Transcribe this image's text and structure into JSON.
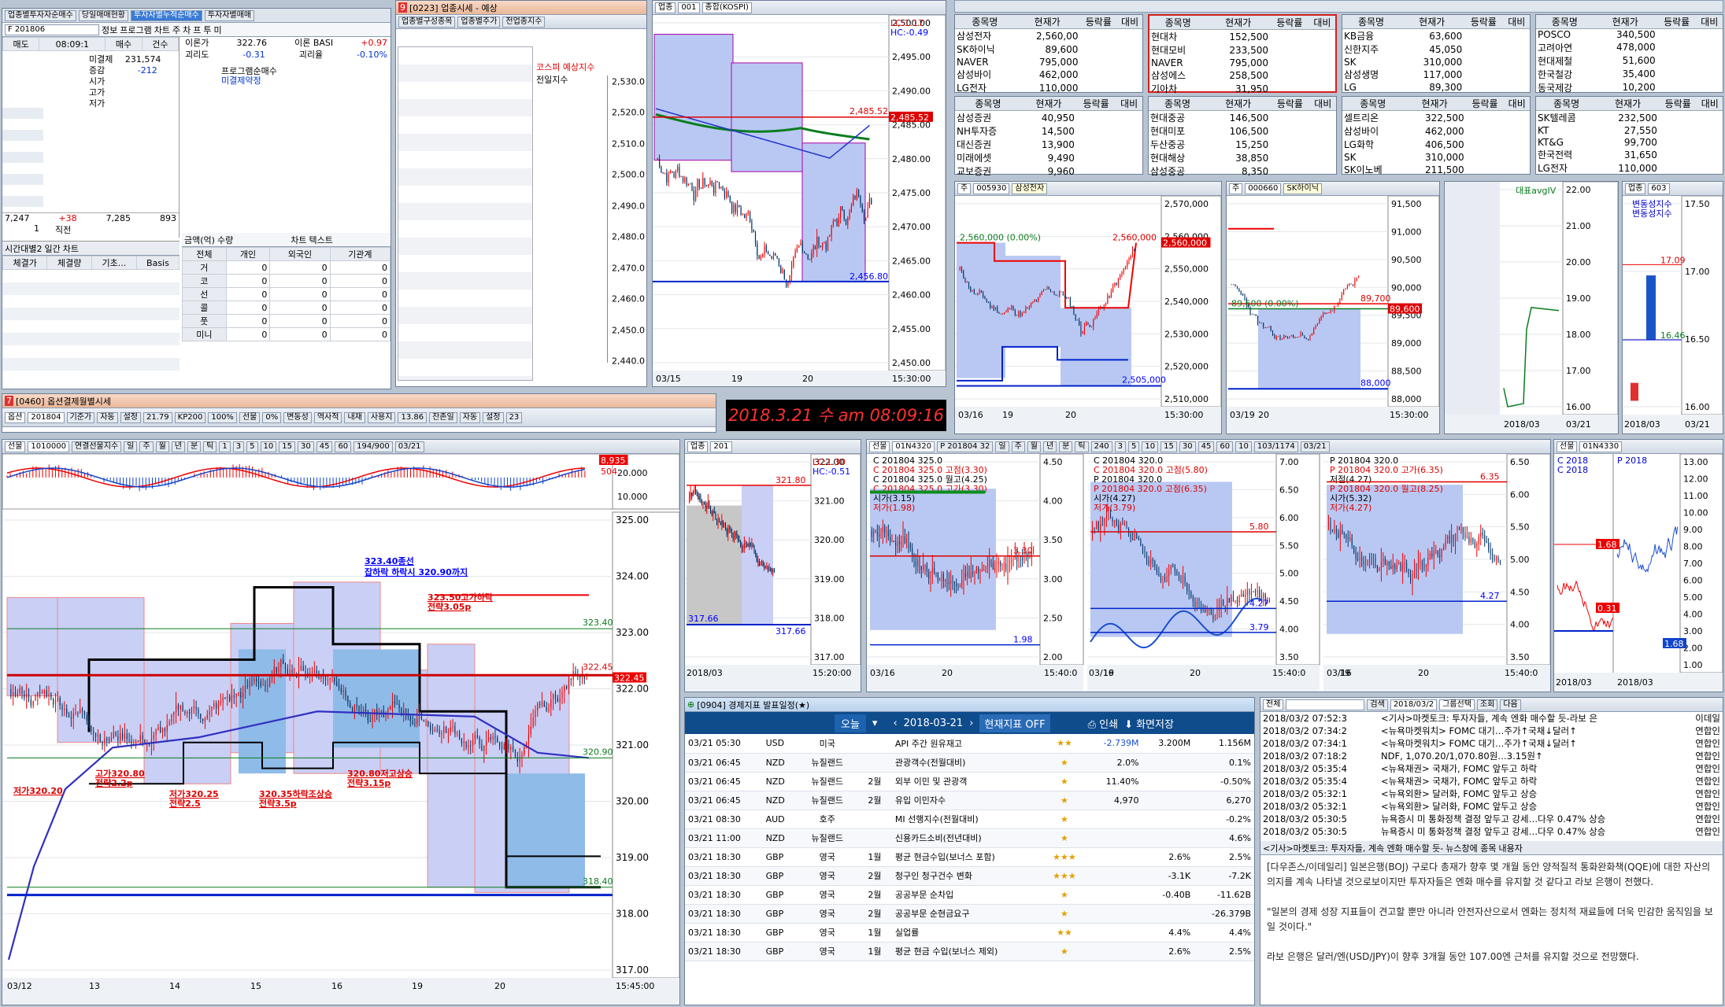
{
  "clock": "2018.3.21 수 am 08:09:16",
  "investor": {
    "tabs": [
      "업종별투자자순매수",
      "당일매매현황",
      "투자자별누적순매수",
      "투자자별매매"
    ],
    "code": "F 201806",
    "opts": [
      "정보",
      "프로그램",
      "차트",
      "주",
      "차",
      "프",
      "투",
      "미"
    ],
    "head": [
      "매도",
      "08:09:1",
      "매수",
      "건수"
    ],
    "rows": [
      [
        "미결제",
        "231,574"
      ],
      [
        "증감",
        "-212"
      ],
      [
        "시가",
        ""
      ],
      [
        "고가",
        ""
      ],
      [
        "저가",
        ""
      ]
    ],
    "bottom": [
      "7,247",
      "+38",
      "7,285",
      "893"
    ],
    "bottom2": [
      "1",
      "직전"
    ],
    "lbl_theory": "이론가",
    "theory": "322.76",
    "lbl_basis": "이론 BASI",
    "basis": "+0.97",
    "lbl_gap": "괴리도",
    "gap": "-0.31",
    "lbl_gaprate": "괴리율",
    "gaprate": "-0.10%",
    "legend": [
      "프로그램순매수",
      "미결제약정"
    ],
    "subtabs": [
      "시간대별2",
      "일간",
      "차트"
    ],
    "sub_head": [
      "체결가",
      "체결량",
      "기초...",
      "Basis"
    ],
    "radios": [
      "금액(억)",
      "수량",
      "차트",
      "텍스트"
    ],
    "inv_head": [
      "전체",
      "개인",
      "외국인",
      "기관계"
    ],
    "inv_rows": [
      [
        "거",
        "0",
        "0",
        "0"
      ],
      [
        "코",
        "0",
        "0",
        "0"
      ],
      [
        "선",
        "0",
        "0",
        "0"
      ],
      [
        "콜",
        "0",
        "0",
        "0"
      ],
      [
        "풋",
        "0",
        "0",
        "0"
      ],
      [
        "미니",
        "0",
        "0",
        "0"
      ]
    ]
  },
  "sector": {
    "title": "[0223] 업종시세 - 예상",
    "tabs": [
      "업종별구성종목",
      "업종별주가",
      "전업종지수"
    ],
    "legend": [
      "코스피 예상지수",
      "전일지수"
    ],
    "yticks": [
      "2,530.0",
      "2,520.0",
      "2,510.0",
      "2,500.0",
      "2,490.0",
      "2,480.0",
      "2,470.0",
      "2,460.0",
      "2,450.0",
      "2,440.0"
    ]
  },
  "kospi": {
    "toolbar": [
      "업종",
      "001",
      "종합(KOSPI)"
    ],
    "lc": "LC:1.17",
    "hc": "HC:-0.49",
    "yticks": [
      "2,500.00",
      "2,495.00",
      "2,490.00",
      "2,485.00",
      "2,480.00",
      "2,475.00",
      "2,470.00",
      "2,465.00",
      "2,460.00",
      "2,455.00",
      "2,450.00"
    ],
    "hi": "2,485.52",
    "lo": "2,456.80",
    "xticks": [
      "03/15",
      "19",
      "20",
      "15:30:00"
    ]
  },
  "quotes": {
    "head": [
      "종목명",
      "현재가",
      "등락률",
      "대비"
    ],
    "groups": [
      [
        [
          "삼성전자",
          "2,560,00"
        ],
        [
          "SK하이닉",
          "89,600"
        ],
        [
          "NAVER",
          "795,000"
        ],
        [
          "삼성바이",
          "462,000"
        ],
        [
          "LG전자",
          "110,000"
        ]
      ],
      [
        [
          "현대차",
          "152,500"
        ],
        [
          "현대모비",
          "233,500"
        ],
        [
          "NAVER",
          "795,000"
        ],
        [
          "삼성에스",
          "258,500"
        ],
        [
          "기아차",
          "31,950"
        ]
      ],
      [
        [
          "KB금융",
          "63,600"
        ],
        [
          "신한지주",
          "45,050"
        ],
        [
          "SK",
          "310,000"
        ],
        [
          "삼성생명",
          "117,000"
        ],
        [
          "LG",
          "89,300"
        ]
      ],
      [
        [
          "POSCO",
          "340,500"
        ],
        [
          "고려아연",
          "478,000"
        ],
        [
          "현대제철",
          "51,600"
        ],
        [
          "한국철강",
          "35,400"
        ],
        [
          "동국제강",
          "10,200"
        ]
      ],
      [
        [
          "삼성증권",
          "40,950"
        ],
        [
          "NH투자증",
          "14,500"
        ],
        [
          "대신증권",
          "13,900"
        ],
        [
          "미래에셋",
          "9,490"
        ],
        [
          "교보증권",
          "9,960"
        ]
      ],
      [
        [
          "현대중공",
          "146,500"
        ],
        [
          "현대미포",
          "106,500"
        ],
        [
          "두산중공",
          "15,250"
        ],
        [
          "현대해상",
          "38,850"
        ],
        [
          "삼성중공",
          "8,350"
        ]
      ],
      [
        [
          "셀트리온",
          "322,500"
        ],
        [
          "삼성바이",
          "462,000"
        ],
        [
          "LG화학",
          "406,500"
        ],
        [
          "SK",
          "310,000"
        ],
        [
          "SK이노베",
          "211,500"
        ]
      ],
      [
        [
          "SK텔레콤",
          "232,500"
        ],
        [
          "KT",
          "27,550"
        ],
        [
          "KT&G",
          "99,700"
        ],
        [
          "한국전력",
          "31,650"
        ],
        [
          "LG전자",
          "110,000"
        ]
      ]
    ]
  },
  "samsung": {
    "toolbar": [
      "주",
      "005930",
      "삼성전자"
    ],
    "box": "2,560,000 (0.00%)",
    "hi": "2,560,000",
    "lo": "2,505,000",
    "yticks": [
      "2,570,000",
      "2,560,000",
      "2,550,000",
      "2,540,000",
      "2,530,000",
      "2,520,000",
      "2,510,000"
    ],
    "xticks": [
      "03/16",
      "19",
      "20",
      "15:30:00"
    ]
  },
  "hynix": {
    "toolbar": [
      "주",
      "000660",
      "SK하이닉"
    ],
    "box": "89,600 (0.00%)",
    "hi": "89,700",
    "cur": "89,600",
    "lo": "88,000",
    "yticks": [
      "91,500",
      "91,000",
      "90,500",
      "90,000",
      "89,500",
      "89,000",
      "88,500",
      "88,000"
    ],
    "xticks": [
      "03/19",
      "20",
      "15:30:00"
    ]
  },
  "avgiv": {
    "legend": "대표avgIV",
    "yticks": [
      "22.00",
      "21.00",
      "20.00",
      "19.00",
      "18.00",
      "17.00",
      "16.00"
    ],
    "xticks": [
      "2018/03",
      "03/21"
    ]
  },
  "futbar": {
    "toolbar": [
      "업종",
      "603"
    ],
    "legend": [
      "변동성지수",
      "변동성지수"
    ],
    "v1": "17.09",
    "v2": "16.46",
    "yticks": [
      "17.50",
      "17.00",
      "16.50",
      "16.00"
    ],
    "xticks": [
      "2018/03",
      "03/21"
    ]
  },
  "optsheet": {
    "title": "[0460] 옵션결제월별시세",
    "toolbar": [
      "옵션",
      "201804",
      "기준가",
      "자동",
      "설정",
      "21.79",
      "KP200",
      "100%",
      "선물",
      "0%",
      "변동성",
      "역사적",
      "내재",
      "사용지",
      "13.86",
      "잔존일",
      "자동",
      "설정",
      "23"
    ]
  },
  "main": {
    "toolbar": [
      "선물",
      "1010000",
      "연결선물지수",
      "일",
      "주",
      "월",
      "년",
      "분",
      "틱",
      "1",
      "3",
      "5",
      "10",
      "15",
      "30",
      "45",
      "60",
      "194/900",
      "03/21"
    ],
    "top_hi": "8,935",
    "top_lo": "504",
    "yticks": [
      "325.00",
      "324.00",
      "323.00",
      "322.00",
      "321.00",
      "320.00",
      "319.00",
      "318.00",
      "317.00"
    ],
    "top_yticks": [
      "20.000",
      "10.000"
    ],
    "annot": [
      "323.40종선",
      "잡하락 하락시 320.90까지",
      "323.50고가하락",
      "전략3.05p",
      "고가320.80",
      "전략2.2p",
      "저가320.25",
      "전략2.5",
      "320.35하락조상승",
      "전략3.5p",
      "320.80저고상승",
      "전략3.15p",
      "저가320.20"
    ],
    "prices": [
      "323.40",
      "322.45",
      "320.90",
      "318.40"
    ],
    "xticks": [
      "03/12",
      "13",
      "14",
      "15",
      "16",
      "19",
      "20",
      "15:45:00"
    ]
  },
  "mini201": {
    "toolbar": [
      "업종",
      "201"
    ],
    "lc": "LC:1.30",
    "hc": "HC:-0.51",
    "hi": "321.80",
    "lo": "317.66",
    "lo2": "317.66",
    "yticks": [
      "322.00",
      "321.00",
      "320.00",
      "319.00",
      "318.00",
      "317.00"
    ],
    "xticks": [
      "2018/03",
      "15:20:00"
    ]
  },
  "opt4320": {
    "toolbar": [
      "선물",
      "01N4320",
      "P 201804 32",
      "일",
      "주",
      "월",
      "년",
      "분",
      "틱",
      "240",
      "3",
      "5",
      "10",
      "15",
      "30",
      "45",
      "60",
      "10",
      "103/1174",
      "03/21"
    ],
    "legend1": [
      "C 201804 325.0",
      "C 201804 325.0 고점(3.30)",
      "C 201804 325.0 월고(4.25)",
      "C 201804 325.0 고가(3.30)",
      "시가(3.15)",
      "저가(1.98)"
    ],
    "legend2": [
      "C 201804 320.0",
      "C 201804 320.0 고점(5.80)",
      "P 201804 320.0",
      "P 201804 320.0 고점(6.35)",
      "시가(4.27)",
      "저가(3.79)"
    ],
    "legend3": [
      "P 201804 320.0",
      "P 201804 320.0 고가(6.35)",
      "저점(4.27)",
      "P 201804 320.0 월고(8.25)",
      "시가(5.32)",
      "저가(4.27)"
    ],
    "c1": [
      "3.30",
      "1.98"
    ],
    "c2": [
      "5.80",
      "4.27",
      "3.79"
    ],
    "c3": [
      "6.35",
      "4.27"
    ],
    "y1": [
      "4.50",
      "4.00",
      "3.50",
      "3.00",
      "2.50",
      "2.00"
    ],
    "y2": [
      "7.00",
      "6.50",
      "6.00",
      "5.50",
      "5.00",
      "4.50",
      "4.00",
      "3.50"
    ],
    "y3": [
      "6.50",
      "6.00",
      "5.50",
      "5.00",
      "4.50",
      "4.00",
      "3.50"
    ],
    "xticks": [
      "03/16",
      "20",
      "15:40:0",
      "03/16",
      "19",
      "20",
      "15:40:0",
      "03/16",
      "19",
      "20",
      "15:40:0"
    ]
  },
  "opt4330": {
    "toolbar": [
      "선물",
      "01N4330"
    ],
    "legend": [
      "C 2018",
      "P 2018",
      "C 2018"
    ],
    "v1": "1.68",
    "v2": "0.31",
    "v3": "1.68",
    "yticks": [
      "13.00",
      "12.00",
      "11.00",
      "10.00",
      "9.00",
      "8.00",
      "7.00",
      "6.00",
      "5.00",
      "4.00",
      "3.00",
      "2.00",
      "1.00"
    ],
    "xticks": [
      "2018/03",
      "2018/03"
    ]
  },
  "econ": {
    "title": "[0904] 경제지표 발표일정(★)",
    "today": "오늘",
    "date": "2018-03-21",
    "toggle": "현재지표 OFF",
    "print": "인쇄",
    "save": "화면저장",
    "rows": [
      [
        "03/21 05:30",
        "USD",
        "미국",
        "",
        "API 주간 원유재고",
        "★★",
        "-2.739M",
        "3.200M",
        "1.156M"
      ],
      [
        "03/21 06:45",
        "NZD",
        "뉴질랜드",
        "",
        "관광객수(전월대비)",
        "★",
        "2.0%",
        "",
        "0.1%"
      ],
      [
        "03/21 06:45",
        "NZD",
        "뉴질랜드",
        "2월",
        "외부 이민 및 관광객",
        "★",
        "11.40%",
        "",
        "-0.50%"
      ],
      [
        "03/21 06:45",
        "NZD",
        "뉴질랜드",
        "2월",
        "유입 이민자수",
        "★",
        "4,970",
        "",
        "6,270"
      ],
      [
        "03/21 08:30",
        "AUD",
        "호주",
        "",
        "MI 선행지수(전월대비)",
        "★",
        "",
        "",
        "-0.2%"
      ],
      [
        "03/21 11:00",
        "NZD",
        "뉴질랜드",
        "",
        "신용카드소비(전년대비)",
        "★",
        "",
        "",
        "4.6%"
      ],
      [
        "03/21 18:30",
        "GBP",
        "영국",
        "1월",
        "평균 현금수입(보너스 포함)",
        "★★★",
        "",
        "2.6%",
        "2.5%"
      ],
      [
        "03/21 18:30",
        "GBP",
        "영국",
        "2월",
        "청구인 청구건수 변화",
        "★★★",
        "",
        "-3.1K",
        "-7.2K"
      ],
      [
        "03/21 18:30",
        "GBP",
        "영국",
        "2월",
        "공공부문 순차입",
        "★",
        "",
        "-0.40B",
        "-11.62B"
      ],
      [
        "03/21 18:30",
        "GBP",
        "영국",
        "2월",
        "공공부문 순현금요구",
        "★",
        "",
        "",
        "-26.379B"
      ],
      [
        "03/21 18:30",
        "GBP",
        "영국",
        "1월",
        "실업률",
        "★★",
        "",
        "4.4%",
        "4.4%"
      ],
      [
        "03/21 18:30",
        "GBP",
        "영국",
        "1월",
        "평균 현금 수입(보너스 제외)",
        "★",
        "",
        "2.6%",
        "2.5%"
      ]
    ]
  },
  "news": {
    "toolbar": [
      "전체",
      "검색",
      "2018/03/2",
      "그룹선택",
      "조회",
      "다음"
    ],
    "rows": [
      [
        "2018/03/2 07:52:3",
        "<기사>마켓토크: 투자자들, 계속 엔화 매수할 듯-라보 은",
        "이데일"
      ],
      [
        "2018/03/2 07:34:2",
        "<뉴욕마켓워치> FOMC 대기…주가↑국채↓달러↑",
        "연합인"
      ],
      [
        "2018/03/2 07:34:1",
        "<뉴욕마켓워치> FOMC 대기…주가↑국채↓달러↑",
        "연합인"
      ],
      [
        "2018/03/2 07:18:2",
        "NDF, 1,070.20/1,070.80원…3.15원↑",
        "연합인"
      ],
      [
        "2018/03/2 05:35:4",
        "<뉴욕채권> 국채가, FOMC 앞두고 하락",
        "연합인"
      ],
      [
        "2018/03/2 05:35:4",
        "<뉴욕채권> 국채가, FOMC 앞두고 하락",
        "연합인"
      ],
      [
        "2018/03/2 05:32:1",
        "<뉴욕외환> 달러화, FOMC 앞두고 상승",
        "연합인"
      ],
      [
        "2018/03/2 05:32:1",
        "<뉴욕외환> 달러화, FOMC 앞두고 상승",
        "연합인"
      ],
      [
        "2018/03/2 05:30:5",
        "뉴욕증시 미 통화정책 결정 앞두고 강세…다우 0.47% 상승",
        "연합인"
      ],
      [
        "2018/03/2 05:30:5",
        "뉴욕증시 미 통화정책 결정 앞두고 강세…다우 0.47% 상승",
        "연합인"
      ]
    ],
    "detail_title": "<기사>마켓토크: 투자자들, 계속 엔화 매수할 듯-",
    "detail_opts": [
      "뉴스창에 종목",
      "내용자"
    ],
    "body": [
      "[다우존스/이데일리] 일본은행(BOJ) 구로다 총재가 향후 몇 개월 동안 양적질적 통화완화책(QQE)에 대한 자산의 의지를 계속 나타낼 것으로보이지만 투자자들은 엔화 매수를 유지할 것 같다고 라보 은행이 전했다.",
      "\"일본의 경제 성장 지표들이 견고할 뿐만 아니라 안전자산으로서 엔화는 정치적 재료들에 더욱 민감한 움직임을 보일 것이다.\"",
      "라보 은행은 달러/엔(USD/JPY)이 향후 3개월 동안 107.00엔 근처를 유지할 것으로 전망했다."
    ]
  }
}
